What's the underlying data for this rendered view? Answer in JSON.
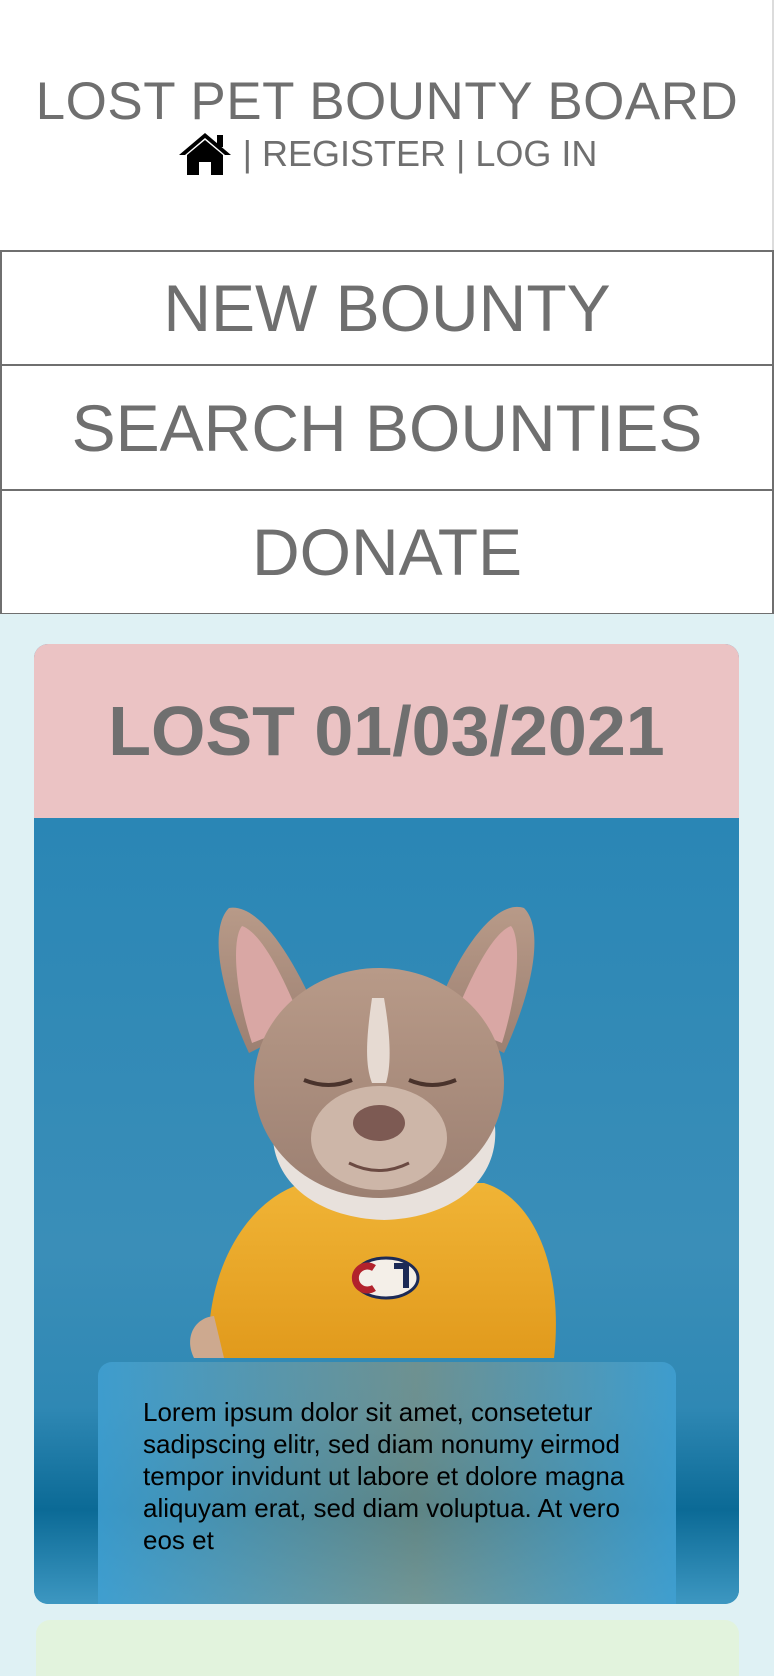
{
  "header": {
    "title": "LOST PET BOUNTY BOARD",
    "separator": "|",
    "register_label": "REGISTER",
    "login_label": "LOG IN"
  },
  "menu": {
    "new_bounty_label": "NEW BOUNTY",
    "search_bounties_label": "SEARCH BOUNTIES",
    "donate_label": "DONATE"
  },
  "bounty_card": {
    "status_label": "LOST 01/03/2021",
    "description": "Lorem ipsum dolor sit amet, consetetur sadipscing elitr, sed diam nonumy eirmod tempor invidunt ut labore et dolore magna aliquyam erat, sed diam voluptua. At vero eos et"
  },
  "colors": {
    "text_gray": "#6f6f6f",
    "feed_background": "#dff1f4",
    "lost_header": "#ebc3c4",
    "next_card": "#e2f3dd",
    "photo_background": "#2f8fb8"
  },
  "icons": {
    "home": "house-icon"
  }
}
